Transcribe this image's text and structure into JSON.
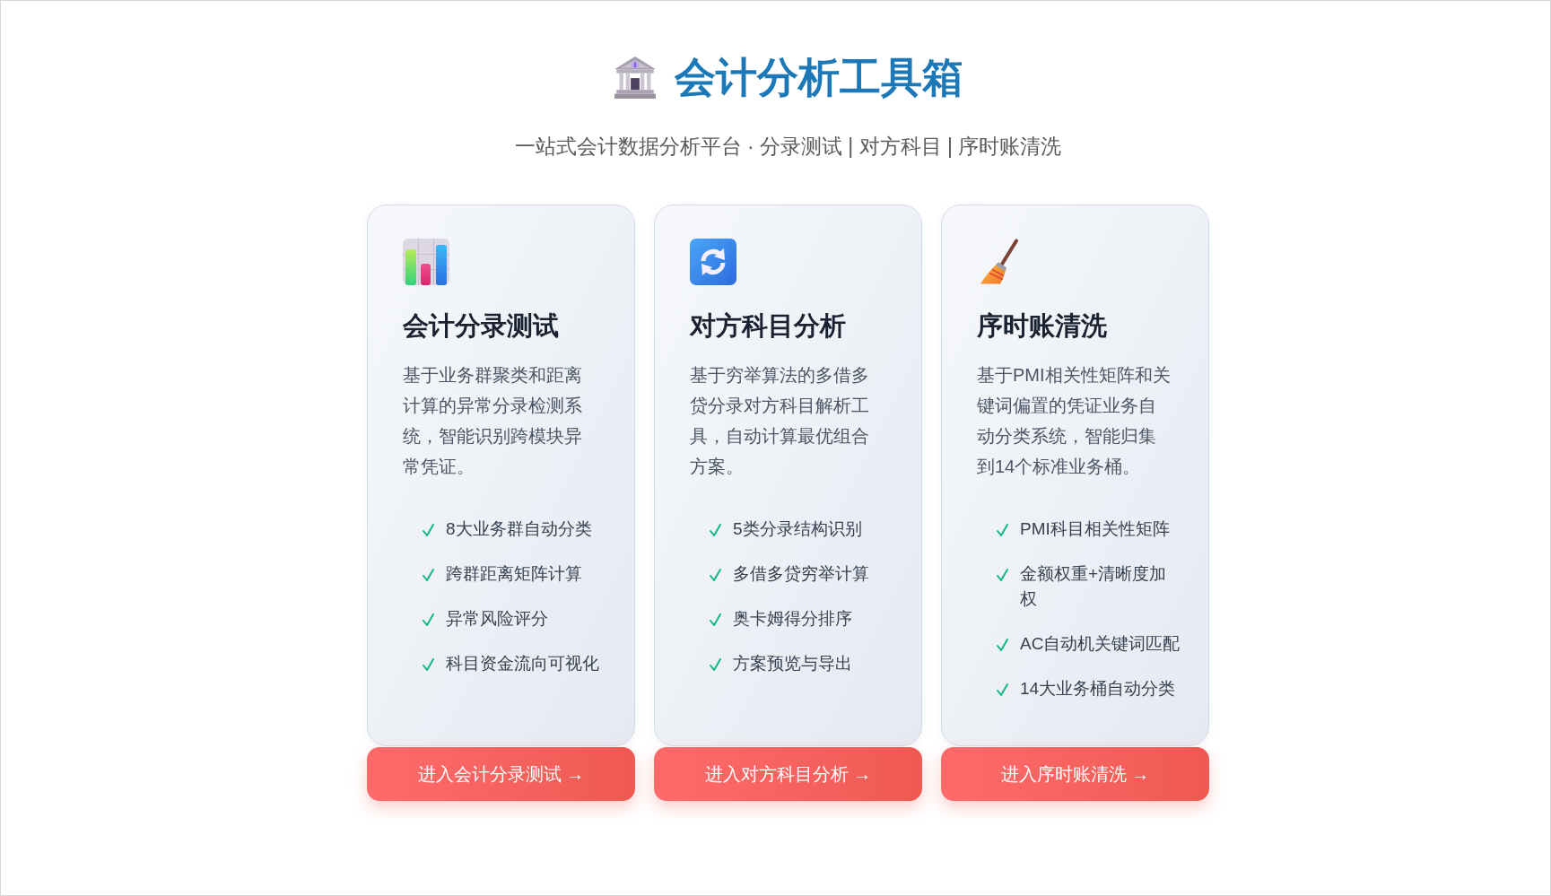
{
  "header": {
    "title": "会计分析工具箱",
    "subtitle": "一站式会计数据分析平台 · 分录测试 | 对方科目 | 序时账清洗"
  },
  "tools": [
    {
      "kind": "chart",
      "title": "会计分录测试",
      "description": "基于业务群聚类和距离计算的异常分录检测系统，智能识别跨模块异常凭证。",
      "features": [
        "8大业务群自动分类",
        "跨群距离矩阵计算",
        "异常风险评分",
        "科目资金流向可视化"
      ],
      "button": "进入会计分录测试 →"
    },
    {
      "kind": "refresh",
      "title": "对方科目分析",
      "description": "基于穷举算法的多借多贷分录对方科目解析工具，自动计算最优组合方案。",
      "features": [
        "5类分录结构识别",
        "多借多贷穷举计算",
        "奥卡姆得分排序",
        "方案预览与导出"
      ],
      "button": "进入对方科目分析 →"
    },
    {
      "kind": "broom",
      "title": "序时账清洗",
      "description": "基于PMI相关性矩阵和关键词偏置的凭证业务自动分类系统，智能归集到14个标准业务桶。",
      "features": [
        "PMI科目相关性矩阵",
        "金额权重+清晰度加权",
        "AC自动机关键词匹配",
        "14大业务桶自动分类"
      ],
      "button": "进入序时账清洗 →"
    }
  ]
}
